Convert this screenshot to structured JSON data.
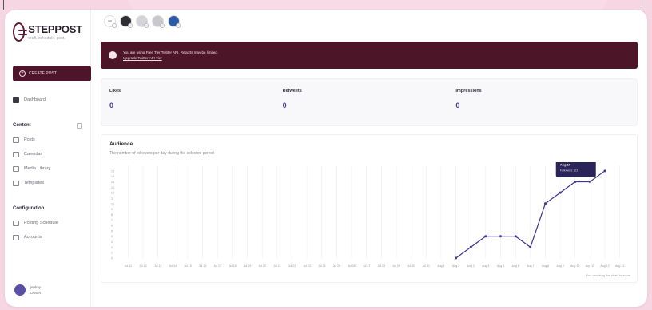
{
  "app": {
    "name": "STEPPOST",
    "tagline": "draft. schedule. post."
  },
  "sidebar": {
    "create_label": "CREATE POST",
    "dashboard_label": "Dashboard",
    "content_section": "Content",
    "content_items": [
      "Posts",
      "Calendar",
      "Media Library",
      "Templates"
    ],
    "config_section": "Configuration",
    "config_items": [
      "Posting Schedule",
      "Accounts"
    ],
    "user_name": "jenkay",
    "user_role": "Owner"
  },
  "accounts": [
    {
      "label": "Add",
      "bg": "#ffffff",
      "badge": "+"
    },
    {
      "label": "",
      "bg": "#2e2e34",
      "badge": "t"
    },
    {
      "label": "",
      "bg": "#d3d3d8",
      "badge": "t"
    },
    {
      "label": "",
      "bg": "#c8c8ce",
      "badge": "t"
    },
    {
      "label": "",
      "bg": "#2c5aa6",
      "badge": "t"
    }
  ],
  "alert": {
    "line1": "You are using Free Tier Twitter API. Reports may be limited.",
    "line2": "Upgrade Twitter API Tier"
  },
  "stats": [
    {
      "label": "Likes",
      "value": "0"
    },
    {
      "label": "Retweets",
      "value": "0"
    },
    {
      "label": "Impressions",
      "value": "0"
    }
  ],
  "audience": {
    "title": "Audience",
    "subtitle": "The number of followers per day during the selected period",
    "footer": "You can drag the chart to zoom"
  },
  "chart_data": {
    "type": "line",
    "x": [
      "Jul 11",
      "Jul 12",
      "Jul 13",
      "Jul 14",
      "Jul 15",
      "Jul 16",
      "Jul 17",
      "Jul 18",
      "Jul 19",
      "Jul 20",
      "Jul 21",
      "Jul 22",
      "Jul 23",
      "Jul 24",
      "Jul 25",
      "Jul 26",
      "Jul 27",
      "Jul 28",
      "Jul 29",
      "Jul 30",
      "Jul 31",
      "Aug 1",
      "Aug 2",
      "Aug 3",
      "Aug 4",
      "Aug 5",
      "Aug 6",
      "Aug 7",
      "Aug 8",
      "Aug 9",
      "Aug 10",
      "Aug 11",
      "Aug 12",
      "Aug 13"
    ],
    "series": [
      {
        "values": [
          null,
          null,
          null,
          null,
          null,
          null,
          null,
          null,
          null,
          null,
          null,
          null,
          null,
          null,
          null,
          null,
          null,
          null,
          null,
          null,
          null,
          null,
          0,
          2,
          4,
          4,
          4,
          2,
          10,
          12,
          14,
          14,
          16,
          null
        ]
      }
    ],
    "yticks": [
      "0",
      "1",
      "2",
      "3",
      "4",
      "5",
      "6",
      "7",
      "8",
      "9",
      "10",
      "11",
      "12",
      "13",
      "14",
      "15",
      "16"
    ],
    "ylim": [
      0,
      17
    ],
    "tooltip": {
      "date": "Aug 10",
      "text": "Followers: 116"
    },
    "colors": {
      "line": "#3e3591",
      "grid": "#ececf0",
      "tooltip_bg": "#2a2458"
    }
  }
}
